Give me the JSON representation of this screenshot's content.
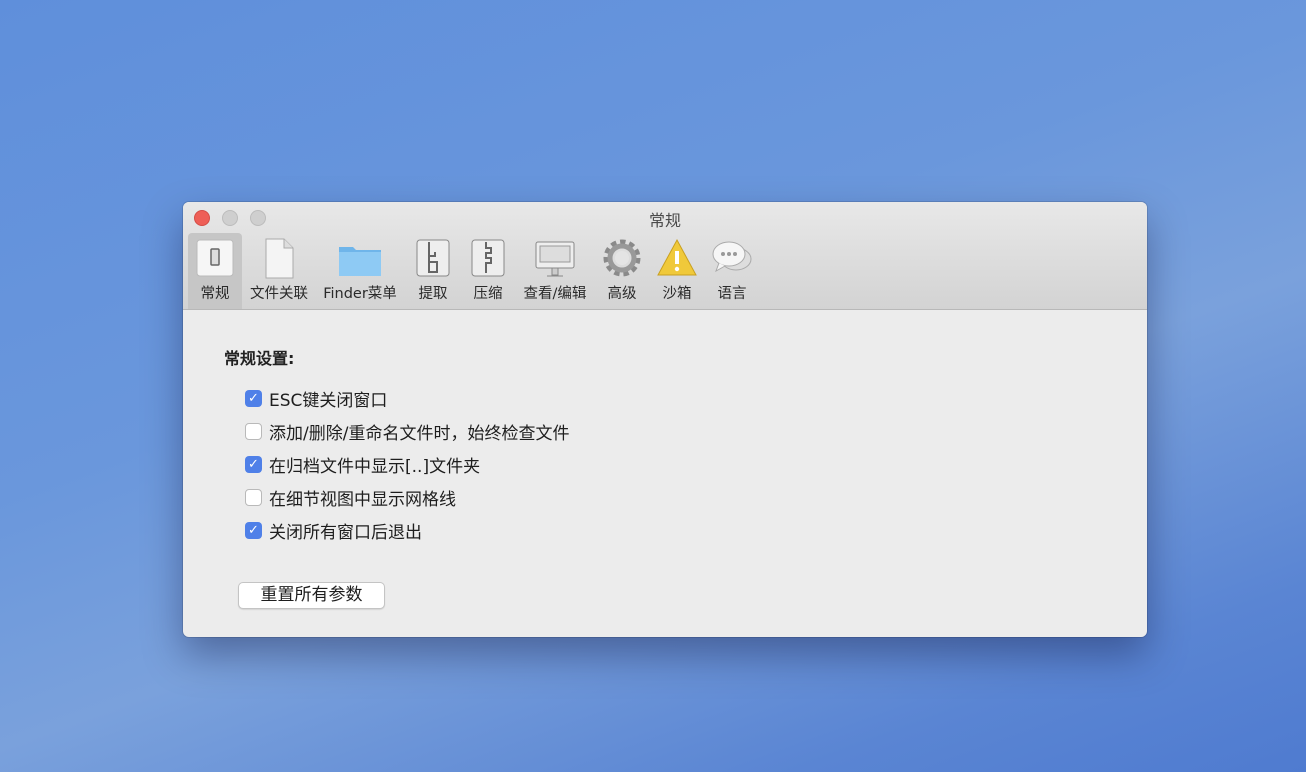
{
  "window": {
    "title": "常规"
  },
  "toolbar": [
    {
      "label": "常规",
      "icon": "switch-icon",
      "selected": true
    },
    {
      "label": "文件关联",
      "icon": "document-icon"
    },
    {
      "label": "Finder菜单",
      "icon": "folder-icon"
    },
    {
      "label": "提取",
      "icon": "extract-zip-icon"
    },
    {
      "label": "压缩",
      "icon": "compress-zip-icon"
    },
    {
      "label": "查看/编辑",
      "icon": "monitor-icon"
    },
    {
      "label": "高级",
      "icon": "gear-icon"
    },
    {
      "label": "沙箱",
      "icon": "warning-icon"
    },
    {
      "label": "语言",
      "icon": "speech-bubbles-icon"
    }
  ],
  "main": {
    "section_title": "常规设置:",
    "options": [
      {
        "label": "ESC键关闭窗口",
        "checked": true
      },
      {
        "label": "添加/删除/重命名文件时，始终检查文件",
        "checked": false
      },
      {
        "label": "在归档文件中显示[..]文件夹",
        "checked": true
      },
      {
        "label": "在细节视图中显示网格线",
        "checked": false
      },
      {
        "label": "关闭所有窗口后退出",
        "checked": true
      }
    ],
    "reset_button": "重置所有参数",
    "check_mark": "✓"
  },
  "colors": {
    "accent": "#4f80e8",
    "close": "#ee5f57"
  }
}
